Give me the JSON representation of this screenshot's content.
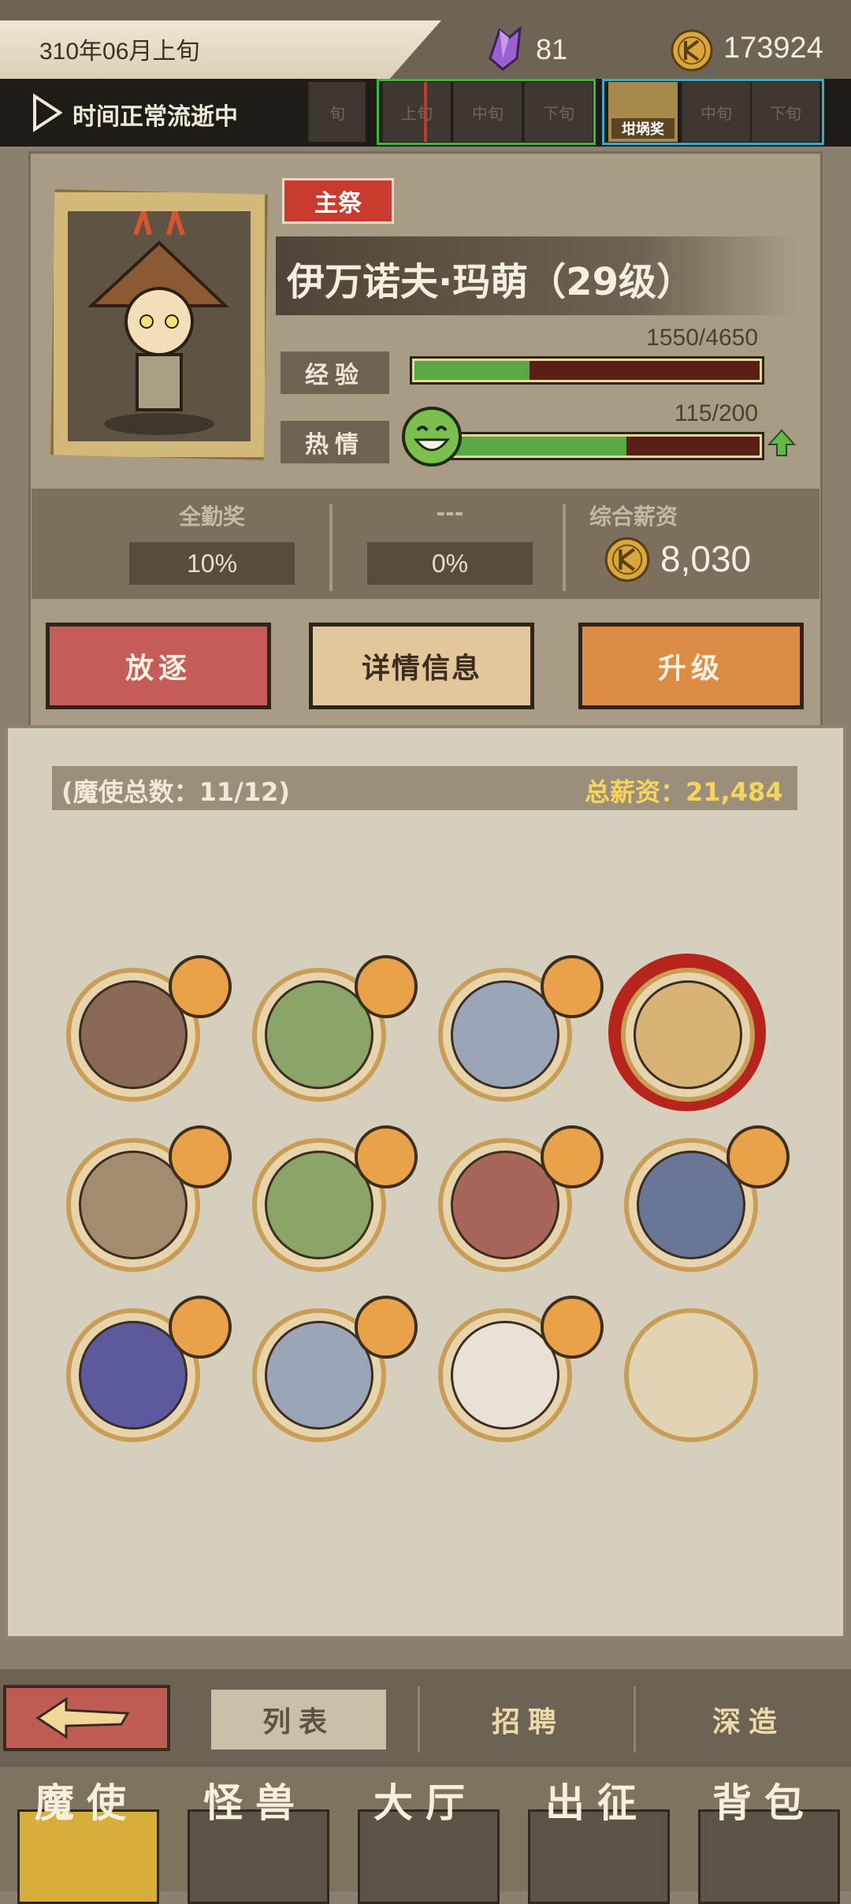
{
  "topbar": {
    "date": "310年06月上旬",
    "gems": "81",
    "coins": "173924",
    "time_status": "时间正常流逝中",
    "periods": [
      "旬",
      "上旬",
      "中旬",
      "下旬",
      "中旬",
      "下旬"
    ],
    "award_label": "坩埚奖"
  },
  "character": {
    "role": "主祭",
    "name": "伊万诺夫·玛萌（29级）",
    "exp_label": "经验",
    "exp_value": "1550/4650",
    "exp_fraction": 0.333,
    "passion_label": "热情",
    "passion_value": "115/200",
    "passion_fraction": 0.575
  },
  "stats": {
    "attendance_title": "全勤奖",
    "attendance_value": "10%",
    "second_title": "---",
    "second_value": "0%",
    "salary_title": "综合薪资",
    "salary_value": "8,030"
  },
  "actions": {
    "exile": "放逐",
    "details": "详情信息",
    "upgrade": "升级"
  },
  "roster": {
    "count_text": "(魔使总数：11/12)",
    "total_salary_text": "总薪资：21,484"
  },
  "tabs": {
    "list": "列表",
    "recruit": "招聘",
    "forge": "深造"
  },
  "main_nav": [
    "魔使",
    "怪兽",
    "大厅",
    "出征",
    "背包"
  ],
  "colors": {
    "exp_fill": "#58a844",
    "bar_track": "#5a2017",
    "exile_button": "#c65c5a",
    "details_button": "#e2c79a",
    "upgrade_button": "#dd8c45",
    "salary_highlight": "#f6d45e"
  },
  "icons": {
    "gem": "purple-crystal-icon",
    "coin": "rune-coin-icon",
    "play": "play-icon",
    "smile": "smile-face-icon",
    "arrow": "up-arrow-icon",
    "back": "back-arrow-icon"
  }
}
